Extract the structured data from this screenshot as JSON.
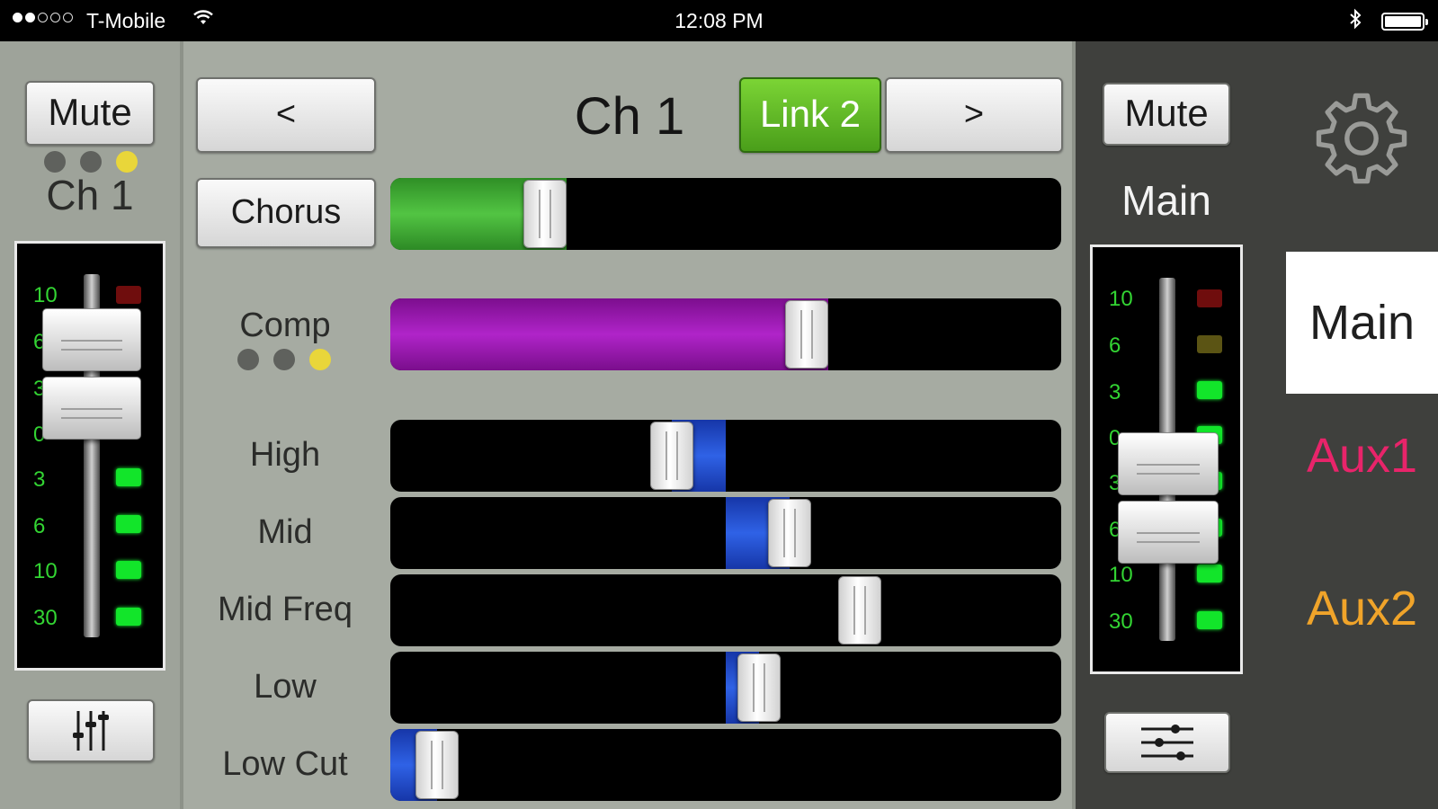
{
  "status_bar": {
    "carrier": "T-Mobile",
    "time": "12:08 PM",
    "signal_bars_filled": 2,
    "signal_bars_total": 5,
    "battery_level": "full"
  },
  "left_strip": {
    "mute_label": "Mute",
    "channel_name": "Ch 1",
    "indicator_dots": [
      "off",
      "off",
      "yellow"
    ],
    "scale_labels": [
      "10",
      "6",
      "3",
      "0",
      "3",
      "6",
      "10",
      "30"
    ],
    "meter_leds": [
      "red",
      "off",
      "off",
      "off",
      "green",
      "green",
      "green",
      "green"
    ],
    "eq_button_icon": "vertical-sliders-icon"
  },
  "channel_header": {
    "prev_label": "<",
    "channel_title": "Ch 1",
    "link_label": "Link 2",
    "next_label": ">"
  },
  "effects": {
    "effect_button_label": "Chorus",
    "effect_level": 0.23,
    "effect_color": "#3aa12f",
    "comp_label": "Comp",
    "comp_dots": [
      "off",
      "off",
      "yellow"
    ],
    "comp_level": 0.62,
    "comp_color": "#9a16b0"
  },
  "eq": [
    {
      "label": "High",
      "value": -0.16
    },
    {
      "label": "Mid",
      "value": 0.19
    },
    {
      "label": "Mid Freq",
      "value": 0.7
    },
    {
      "label": "Low",
      "value": 0.1
    },
    {
      "label": "Low Cut",
      "value": 0.07
    }
  ],
  "right_strip": {
    "mute_label": "Mute",
    "bus_name": "Main",
    "scale_labels": [
      "10",
      "6",
      "3",
      "0",
      "3",
      "6",
      "10",
      "30"
    ],
    "meter_leds": [
      "red",
      "yellow",
      "green",
      "green",
      "green",
      "green",
      "green",
      "green"
    ],
    "eq_button_icon": "horizontal-sliders-icon"
  },
  "bus_selector": {
    "settings_icon": "gear-icon",
    "buses": [
      {
        "label": "Main",
        "color": "#1f1f1f",
        "selected": true
      },
      {
        "label": "Aux1",
        "color": "#e8246a",
        "selected": false
      },
      {
        "label": "Aux2",
        "color": "#f0a42a",
        "selected": false
      }
    ]
  }
}
